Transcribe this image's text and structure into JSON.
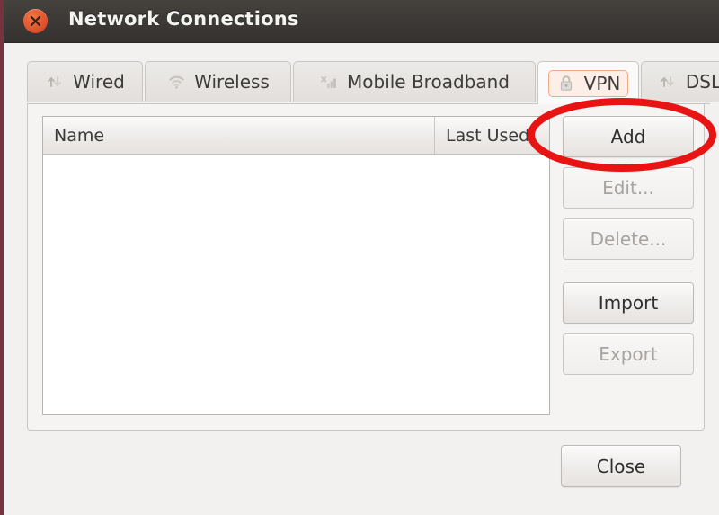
{
  "window": {
    "title": "Network Connections",
    "close_icon": "close-x-icon",
    "frame_color": "#77323f",
    "titlebar_color": "#3b3835",
    "close_button_color": "#e1502a"
  },
  "tabs": [
    {
      "id": "wired",
      "label": "Wired",
      "icon": "up-down-arrows-icon",
      "active": false
    },
    {
      "id": "wireless",
      "label": "Wireless",
      "icon": "wifi-signal-icon",
      "active": false
    },
    {
      "id": "mobile-broadband",
      "label": "Mobile Broadband",
      "icon": "signal-bars-icon",
      "active": false
    },
    {
      "id": "vpn",
      "label": "VPN",
      "icon": "padlock-icon",
      "active": true
    },
    {
      "id": "dsl",
      "label": "DSL",
      "icon": "up-down-arrows-icon",
      "active": false
    }
  ],
  "connection_list": {
    "columns": [
      "Name",
      "Last Used"
    ],
    "rows": []
  },
  "side_buttons": [
    {
      "id": "add",
      "label": "Add",
      "enabled": true
    },
    {
      "id": "edit",
      "label": "Edit...",
      "enabled": false
    },
    {
      "id": "delete",
      "label": "Delete...",
      "enabled": false
    },
    {
      "id": "import",
      "label": "Import",
      "enabled": true
    },
    {
      "id": "export",
      "label": "Export",
      "enabled": false
    }
  ],
  "dialog_actions": {
    "close_label": "Close"
  },
  "annotation": {
    "shape": "ellipse",
    "color": "#e81414",
    "stroke_width": 8,
    "target": "add-button"
  }
}
